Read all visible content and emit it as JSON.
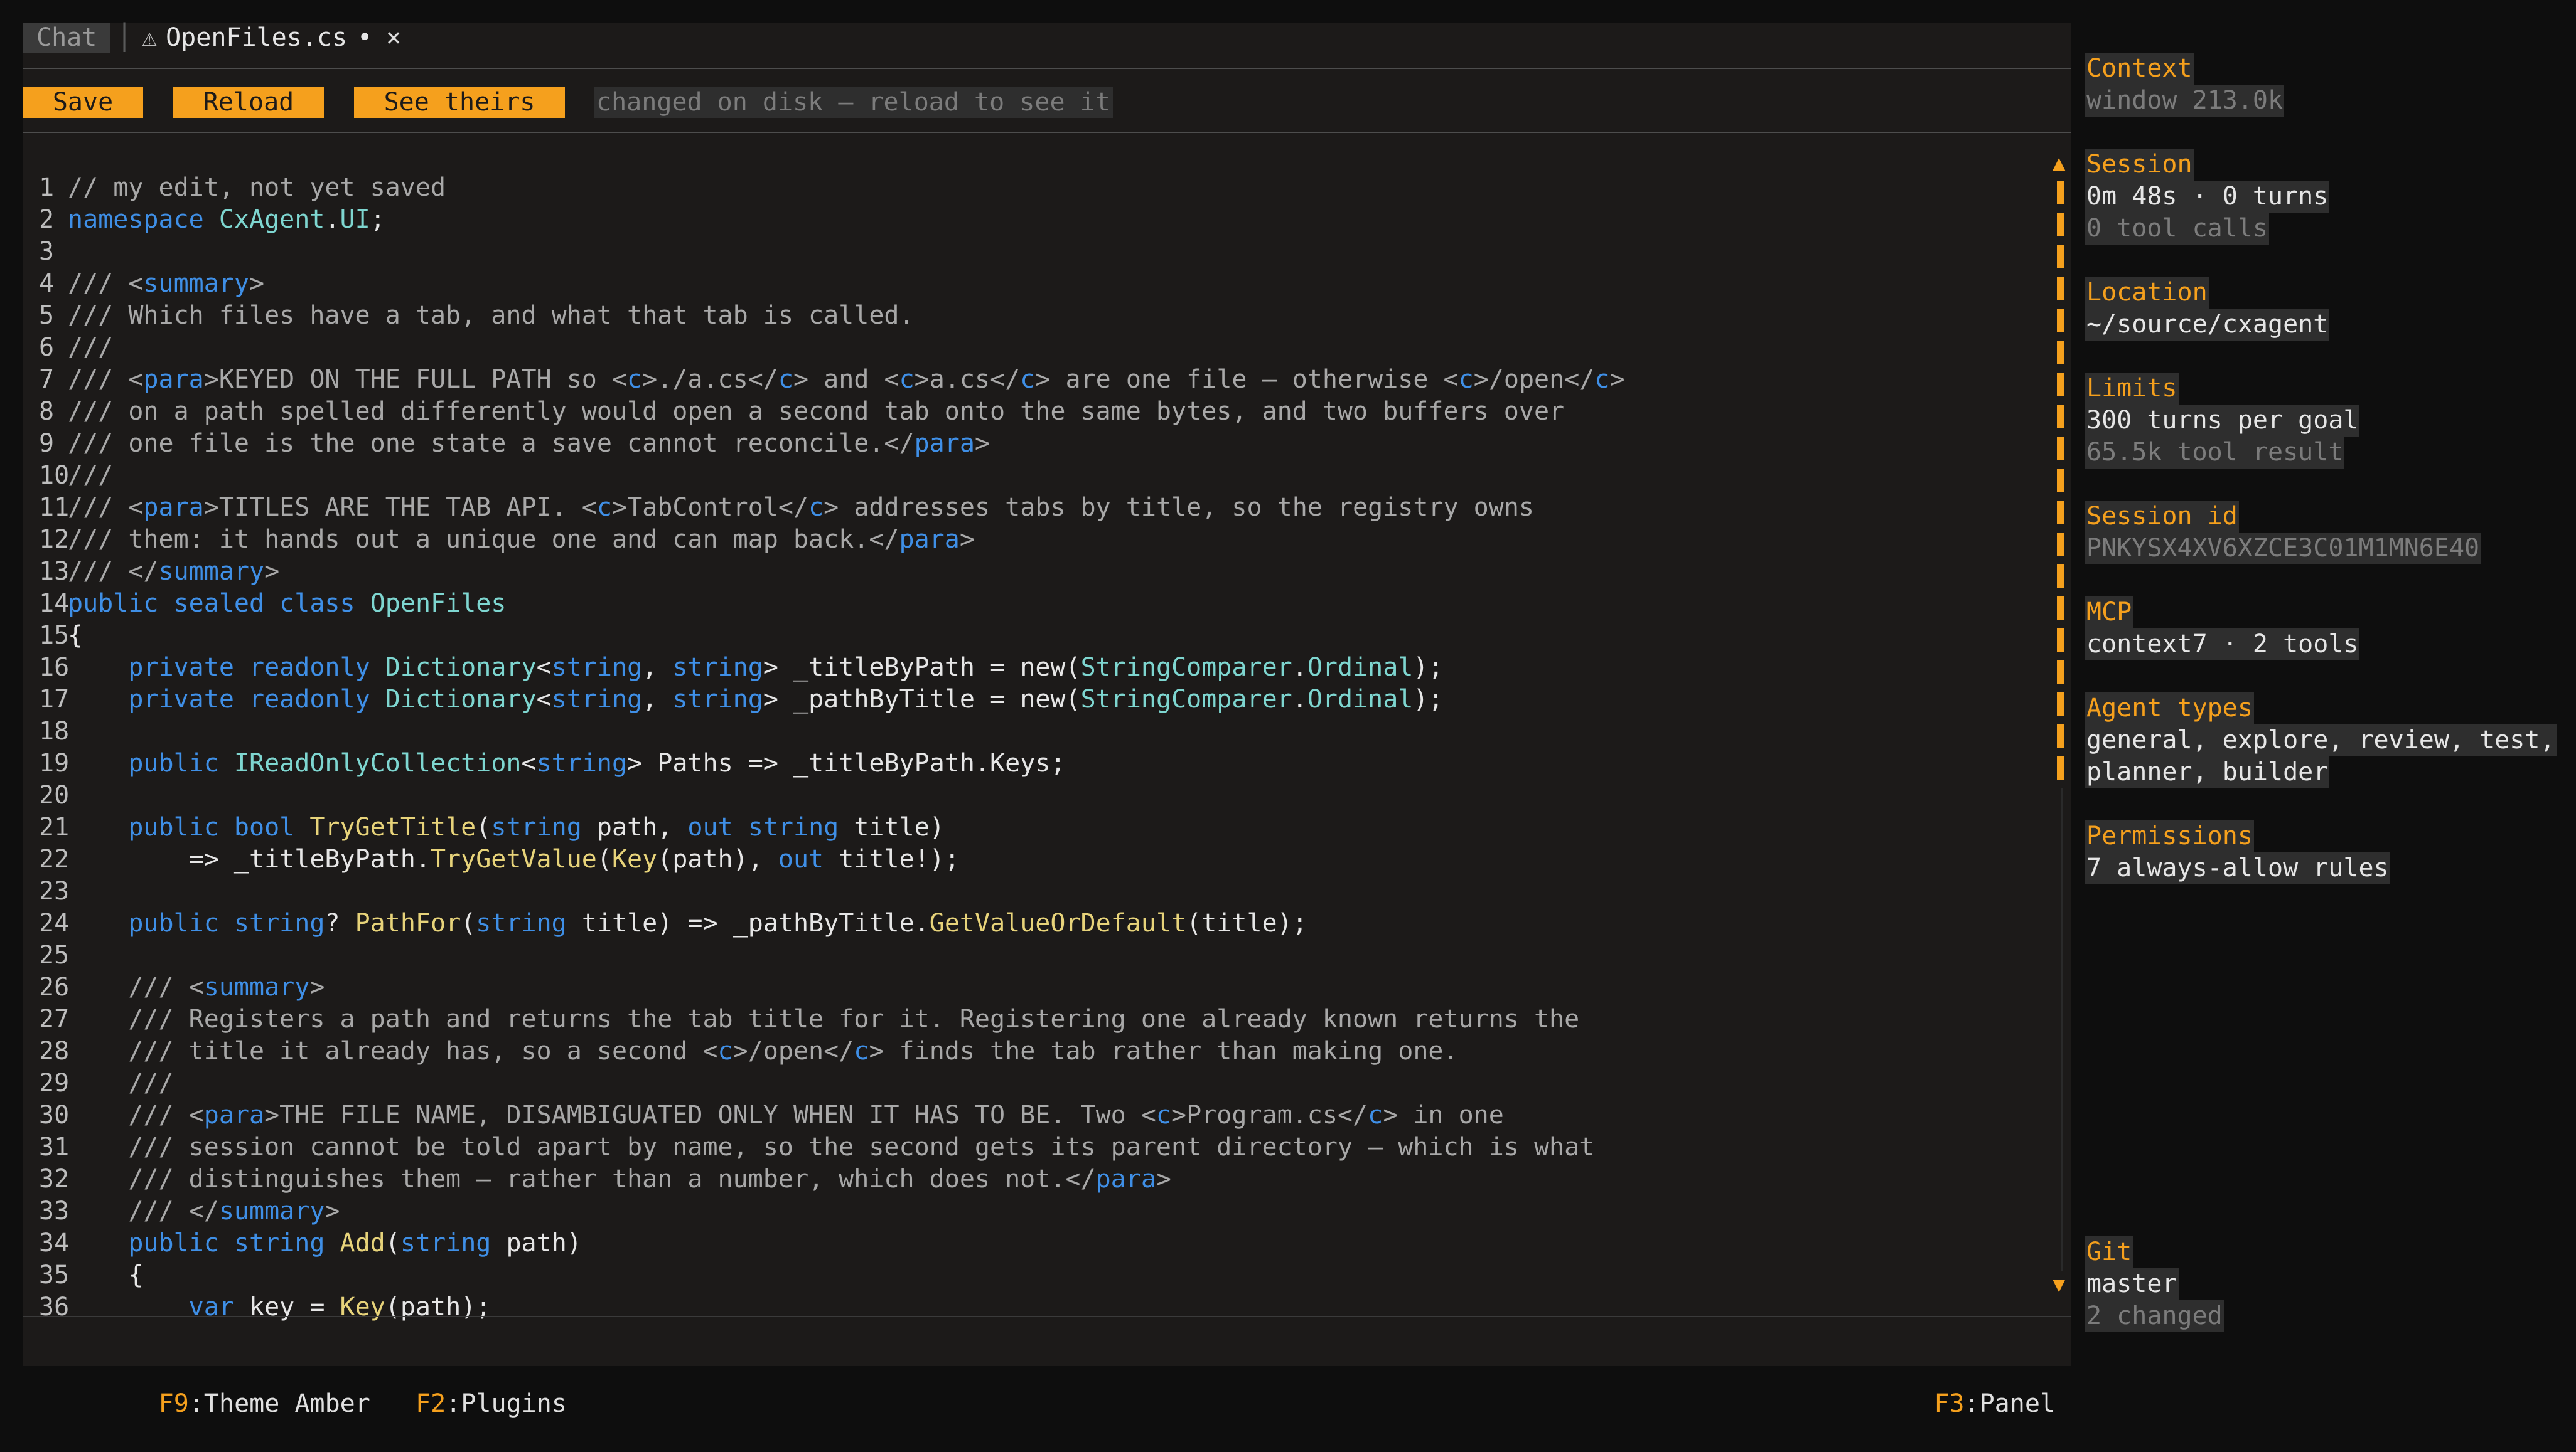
{
  "tabs": {
    "chat_label": "Chat",
    "separator": "│",
    "file_warning_icon": "⚠",
    "file_label": "OpenFiles.cs",
    "modified_marker": "•",
    "close_glyph": "×"
  },
  "toolbar": {
    "save_label": "Save",
    "reload_label": "Reload",
    "see_theirs_label": "See theirs",
    "disk_message": "changed on disk — reload to see it"
  },
  "code": {
    "language": "csharp",
    "lines": [
      [
        [
          "c",
          "// my edit, not yet saved"
        ]
      ],
      [
        [
          "k",
          "namespace"
        ],
        [
          "p",
          " "
        ],
        [
          "t",
          "CxAgent"
        ],
        [
          "p",
          "."
        ],
        [
          "t",
          "UI"
        ],
        [
          "p",
          ";"
        ]
      ],
      [],
      [
        [
          "c",
          "/// <"
        ],
        [
          "k",
          "summary"
        ],
        [
          "c",
          ">"
        ]
      ],
      [
        [
          "c",
          "/// Which files have a tab, and what that tab is called."
        ]
      ],
      [
        [
          "c",
          "///"
        ]
      ],
      [
        [
          "c",
          "/// <"
        ],
        [
          "k",
          "para"
        ],
        [
          "c",
          ">KEYED ON THE FULL PATH so <"
        ],
        [
          "k",
          "c"
        ],
        [
          "c",
          ">./a.cs</"
        ],
        [
          "k",
          "c"
        ],
        [
          "c",
          "> and <"
        ],
        [
          "k",
          "c"
        ],
        [
          "c",
          ">a.cs</"
        ],
        [
          "k",
          "c"
        ],
        [
          "c",
          "> are one file — otherwise <"
        ],
        [
          "k",
          "c"
        ],
        [
          "c",
          ">/open</"
        ],
        [
          "k",
          "c"
        ],
        [
          "c",
          ">"
        ]
      ],
      [
        [
          "c",
          "/// on a path spelled differently would open a second tab onto the same bytes, and two buffers over"
        ]
      ],
      [
        [
          "c",
          "/// one file is the one state a save cannot reconcile.</"
        ],
        [
          "k",
          "para"
        ],
        [
          "c",
          ">"
        ]
      ],
      [
        [
          "c",
          "///"
        ]
      ],
      [
        [
          "c",
          "/// <"
        ],
        [
          "k",
          "para"
        ],
        [
          "c",
          ">TITLES ARE THE TAB API. <"
        ],
        [
          "k",
          "c"
        ],
        [
          "c",
          ">TabControl</"
        ],
        [
          "k",
          "c"
        ],
        [
          "c",
          "> addresses tabs by title, so the registry owns"
        ]
      ],
      [
        [
          "c",
          "/// them: it hands out a unique one and can map back.</"
        ],
        [
          "k",
          "para"
        ],
        [
          "c",
          ">"
        ]
      ],
      [
        [
          "c",
          "/// </"
        ],
        [
          "k",
          "summary"
        ],
        [
          "c",
          ">"
        ]
      ],
      [
        [
          "k",
          "public"
        ],
        [
          "p",
          " "
        ],
        [
          "k",
          "sealed"
        ],
        [
          "p",
          " "
        ],
        [
          "k",
          "class"
        ],
        [
          "p",
          " "
        ],
        [
          "t",
          "OpenFiles"
        ]
      ],
      [
        [
          "p",
          "{"
        ]
      ],
      [
        [
          "p",
          "    "
        ],
        [
          "k",
          "private"
        ],
        [
          "p",
          " "
        ],
        [
          "k",
          "readonly"
        ],
        [
          "p",
          " "
        ],
        [
          "t",
          "Dictionary"
        ],
        [
          "p",
          "<"
        ],
        [
          "k",
          "string"
        ],
        [
          "p",
          ", "
        ],
        [
          "k",
          "string"
        ],
        [
          "p",
          "> _titleByPath = new("
        ],
        [
          "t",
          "StringComparer"
        ],
        [
          "p",
          "."
        ],
        [
          "t",
          "Ordinal"
        ],
        [
          "p",
          ");"
        ]
      ],
      [
        [
          "p",
          "    "
        ],
        [
          "k",
          "private"
        ],
        [
          "p",
          " "
        ],
        [
          "k",
          "readonly"
        ],
        [
          "p",
          " "
        ],
        [
          "t",
          "Dictionary"
        ],
        [
          "p",
          "<"
        ],
        [
          "k",
          "string"
        ],
        [
          "p",
          ", "
        ],
        [
          "k",
          "string"
        ],
        [
          "p",
          "> _pathByTitle = new("
        ],
        [
          "t",
          "StringComparer"
        ],
        [
          "p",
          "."
        ],
        [
          "t",
          "Ordinal"
        ],
        [
          "p",
          ");"
        ]
      ],
      [],
      [
        [
          "p",
          "    "
        ],
        [
          "k",
          "public"
        ],
        [
          "p",
          " "
        ],
        [
          "t",
          "IReadOnlyCollection"
        ],
        [
          "p",
          "<"
        ],
        [
          "k",
          "string"
        ],
        [
          "p",
          "> Paths => _titleByPath.Keys;"
        ]
      ],
      [],
      [
        [
          "p",
          "    "
        ],
        [
          "k",
          "public"
        ],
        [
          "p",
          " "
        ],
        [
          "k",
          "bool"
        ],
        [
          "p",
          " "
        ],
        [
          "f",
          "TryGetTitle"
        ],
        [
          "p",
          "("
        ],
        [
          "k",
          "string"
        ],
        [
          "p",
          " path, "
        ],
        [
          "k",
          "out"
        ],
        [
          "p",
          " "
        ],
        [
          "k",
          "string"
        ],
        [
          "p",
          " title)"
        ]
      ],
      [
        [
          "p",
          "        => _titleByPath."
        ],
        [
          "f",
          "TryGetValue"
        ],
        [
          "p",
          "("
        ],
        [
          "f",
          "Key"
        ],
        [
          "p",
          "(path), "
        ],
        [
          "k",
          "out"
        ],
        [
          "p",
          " title!);"
        ]
      ],
      [],
      [
        [
          "p",
          "    "
        ],
        [
          "k",
          "public"
        ],
        [
          "p",
          " "
        ],
        [
          "k",
          "string"
        ],
        [
          "p",
          "? "
        ],
        [
          "f",
          "PathFor"
        ],
        [
          "p",
          "("
        ],
        [
          "k",
          "string"
        ],
        [
          "p",
          " title) => _pathByTitle."
        ],
        [
          "f",
          "GetValueOrDefault"
        ],
        [
          "p",
          "(title);"
        ]
      ],
      [],
      [
        [
          "p",
          "    "
        ],
        [
          "c",
          "/// <"
        ],
        [
          "k",
          "summary"
        ],
        [
          "c",
          ">"
        ]
      ],
      [
        [
          "p",
          "    "
        ],
        [
          "c",
          "/// Registers a path and returns the tab title for it. Registering one already known returns the"
        ]
      ],
      [
        [
          "p",
          "    "
        ],
        [
          "c",
          "/// title it already has, so a second <"
        ],
        [
          "k",
          "c"
        ],
        [
          "c",
          ">/open</"
        ],
        [
          "k",
          "c"
        ],
        [
          "c",
          "> finds the tab rather than making one."
        ]
      ],
      [
        [
          "p",
          "    "
        ],
        [
          "c",
          "///"
        ]
      ],
      [
        [
          "p",
          "    "
        ],
        [
          "c",
          "/// <"
        ],
        [
          "k",
          "para"
        ],
        [
          "c",
          ">THE FILE NAME, DISAMBIGUATED ONLY WHEN IT HAS TO BE. Two <"
        ],
        [
          "k",
          "c"
        ],
        [
          "c",
          ">Program.cs</"
        ],
        [
          "k",
          "c"
        ],
        [
          "c",
          "> in one"
        ]
      ],
      [
        [
          "p",
          "    "
        ],
        [
          "c",
          "/// session cannot be told apart by name, so the second gets its parent directory — which is what"
        ]
      ],
      [
        [
          "p",
          "    "
        ],
        [
          "c",
          "/// distinguishes them — rather than a number, which does not.</"
        ],
        [
          "k",
          "para"
        ],
        [
          "c",
          ">"
        ]
      ],
      [
        [
          "p",
          "    "
        ],
        [
          "c",
          "/// </"
        ],
        [
          "k",
          "summary"
        ],
        [
          "c",
          ">"
        ]
      ],
      [
        [
          "p",
          "    "
        ],
        [
          "k",
          "public"
        ],
        [
          "p",
          " "
        ],
        [
          "k",
          "string"
        ],
        [
          "p",
          " "
        ],
        [
          "f",
          "Add"
        ],
        [
          "p",
          "("
        ],
        [
          "k",
          "string"
        ],
        [
          "p",
          " path)"
        ]
      ],
      [
        [
          "p",
          "    {"
        ]
      ],
      [
        [
          "p",
          "        "
        ],
        [
          "k",
          "var"
        ],
        [
          "p",
          " key = "
        ],
        [
          "f",
          "Key"
        ],
        [
          "p",
          "(path);"
        ]
      ]
    ]
  },
  "statusbar": {
    "theme_key": "F9",
    "theme_label": ":Theme Amber",
    "plugins_key": "F2",
    "plugins_label": ":Plugins",
    "panel_key": "F3",
    "panel_label": ":Panel"
  },
  "panel": {
    "scroll_up_glyph": "▲",
    "scroll_down_glyph": "▼",
    "context": {
      "title": "Context",
      "window": "window 213.0k"
    },
    "session": {
      "title": "Session",
      "duration": "0m 48s · 0 turns",
      "tool_calls": "0 tool calls"
    },
    "location": {
      "title": "Location",
      "path": "~/source/cxagent"
    },
    "limits": {
      "title": "Limits",
      "turns": "300 turns per goal",
      "tool_result": "65.5k tool result"
    },
    "session_id": {
      "title": "Session id",
      "value": "PNKYSX4XV6XZCE3C01M1MN6E40"
    },
    "mcp": {
      "title": "MCP",
      "value": "context7 · 2 tools"
    },
    "agent_types": {
      "title": "Agent types",
      "line1": "general, explore, review, test,",
      "line2": "planner, builder"
    },
    "permissions": {
      "title": "Permissions",
      "value": "7 always-allow rules"
    },
    "git": {
      "title": "Git",
      "branch": "master",
      "changed": "2 changed"
    }
  },
  "colors": {
    "accent": "#f5a01d",
    "editor_bg": "#1c1a19",
    "page_bg": "#0e0e0e",
    "keyword": "#3f8fe6",
    "type": "#7ed6d0",
    "method": "#e7d37a",
    "comment": "#a8a8a8"
  }
}
